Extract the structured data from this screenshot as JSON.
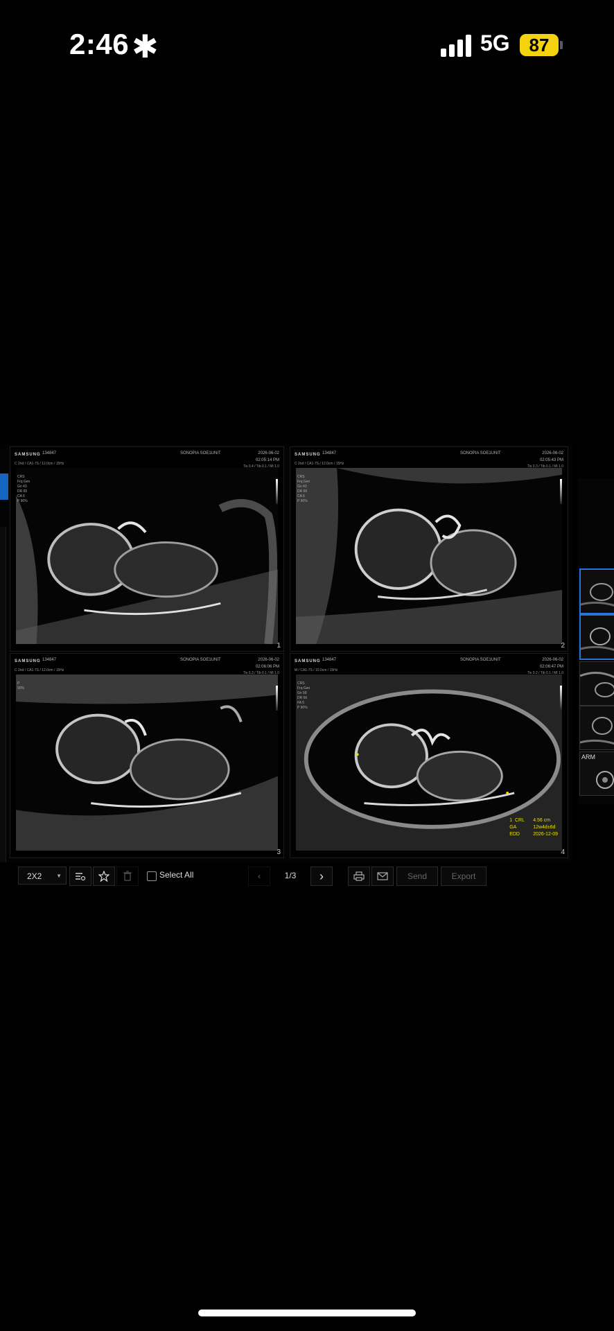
{
  "status_bar": {
    "time": "2:46",
    "activity_glyph": "✱",
    "network": "5G",
    "battery": "87",
    "battery_color": "#f5d20f"
  },
  "panels": [
    {
      "logo": "SAMSUNG",
      "patient_id": "134847",
      "system": "SONOPIA SOE1UNIT",
      "date": "2026-06-02",
      "time": "02:05:14 PM",
      "probe": "C 2nd / CA1-7S / 12.0cm / 15Hz",
      "tis": "Tis 0.4 / Tib 0.1 / MI 1.0",
      "params": "CRS\nFrq Gen\nGn 43\nDR 65\nCA 6\nP 90%",
      "index": "1"
    },
    {
      "logo": "SAMSUNG",
      "patient_id": "134847",
      "system": "SONOPIA SOE1UNIT",
      "date": "2026-06-02",
      "time": "02:05:43 PM",
      "probe": "C 2nd / CA1-7S / 12.0cm / 15Hz",
      "tis": "Tis 0.3 / Tib 0.1 / MI 1.0",
      "params": "CRS\nFrq Gen\nGn 43\nDR 66\nCA 6\nP 90%",
      "index": "2"
    },
    {
      "logo": "SAMSUNG",
      "patient_id": "134847",
      "system": "SONOPIA SOE1UNIT",
      "date": "2026-06-02",
      "time": "02:06:06 PM",
      "probe": "C 2nd / CA1-7S / 12.0cm / 15Hz",
      "tis": "Tis 0.3 / Tib 0.1 / MI 1.0",
      "params": "P\n90%",
      "index": "3"
    },
    {
      "logo": "SAMSUNG",
      "patient_id": "134847",
      "system": "SONOPIA SOE1UNIT",
      "date": "2026-06-02",
      "time": "02:06:47 PM",
      "probe": "M / CA1-7S / 10.0cm / 15Hz",
      "tis": "Tis 0.2 / Tib 0.1 / MI 1.0",
      "params": "CRS\nFrq Gen\nGn 58\nDR 66\nFA 5\nP 90%",
      "index": "4",
      "measurements": [
        {
          "label": "1  CRL",
          "value": "4.56 cm"
        },
        {
          "label": "GA",
          "value": "12w4d±6d"
        },
        {
          "label": "EDD",
          "value": "2026-12-09"
        }
      ],
      "measurement_color": "#e8e000"
    }
  ],
  "toolbar": {
    "layout_select": "2X2",
    "select_all_label": "Select All",
    "page_indicator": "1/3",
    "send_label": "Send",
    "export_label": "Export",
    "icons": [
      "layout-settings-icon",
      "star-icon",
      "trash-icon",
      "prev-page-icon",
      "next-page-icon",
      "print-icon",
      "mail-icon"
    ]
  },
  "thumbnails": {
    "arm_label": "ARM",
    "selected_color": "#2a73d8"
  }
}
